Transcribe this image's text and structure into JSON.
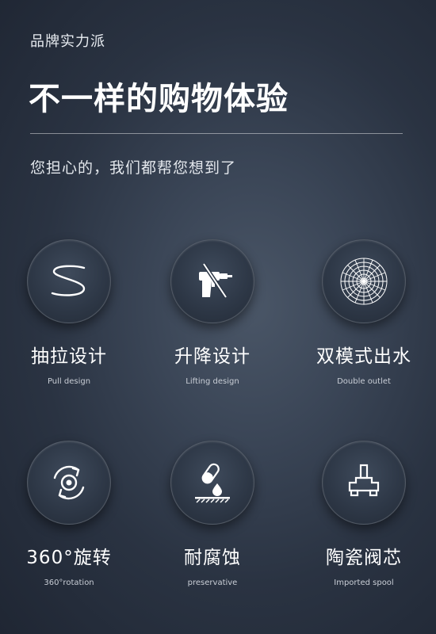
{
  "header": {
    "brand": "品牌实力派",
    "title": "不一样的购物体验",
    "subtitle": "您担心的，我们都帮您想到了"
  },
  "features": [
    {
      "name": "抽拉设计",
      "sub": "Pull design",
      "icon": "s-curve-icon"
    },
    {
      "name": "升降设计",
      "sub": "Lifting design",
      "icon": "spray-gun-icon"
    },
    {
      "name": "双模式出水",
      "sub": "Double outlet",
      "icon": "shower-head-icon"
    },
    {
      "name": "360°旋转",
      "sub": "360°rotation",
      "icon": "rotation-icon"
    },
    {
      "name": "耐腐蚀",
      "sub": "preservative",
      "icon": "corrosion-resistant-icon"
    },
    {
      "name": "陶瓷阀芯",
      "sub": "Imported spool",
      "icon": "valve-core-icon"
    }
  ],
  "colors": {
    "background": "#2a3342",
    "text": "#ffffff",
    "subtext": "#c9ced6"
  }
}
